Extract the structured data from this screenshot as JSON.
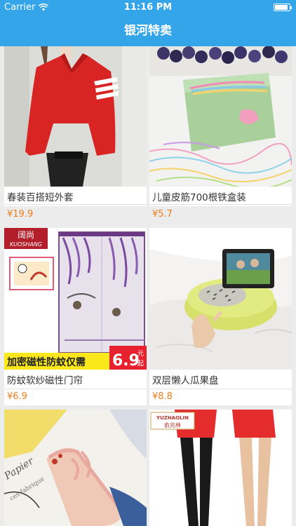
{
  "status": {
    "carrier": "Carrier",
    "time": "11:16 PM",
    "battery_level": 0.9
  },
  "nav": {
    "title": "银河特卖"
  },
  "products": [
    {
      "title": "春装百搭短外套",
      "price": "¥19.9"
    },
    {
      "title": "儿童皮筋700根铁盒装",
      "price": "¥5.7"
    },
    {
      "title": "防蚊软纱磁性门帘",
      "price": "¥6.9"
    },
    {
      "title": "双层懒人瓜果盘",
      "price": "¥8.8"
    },
    {
      "title": "",
      "price": ""
    },
    {
      "title": "",
      "price": ""
    }
  ],
  "banner_text": {
    "brand_cn": "阔尚",
    "brand_en": "KUOSHANG",
    "slogan": "加密磁性防蚊仅需",
    "price": "6.9",
    "price_unit_top": "元",
    "price_unit_bottom": "起",
    "yz_brand_cn": "俞兆林",
    "yz_brand_en": "YUZHAOLIN"
  }
}
